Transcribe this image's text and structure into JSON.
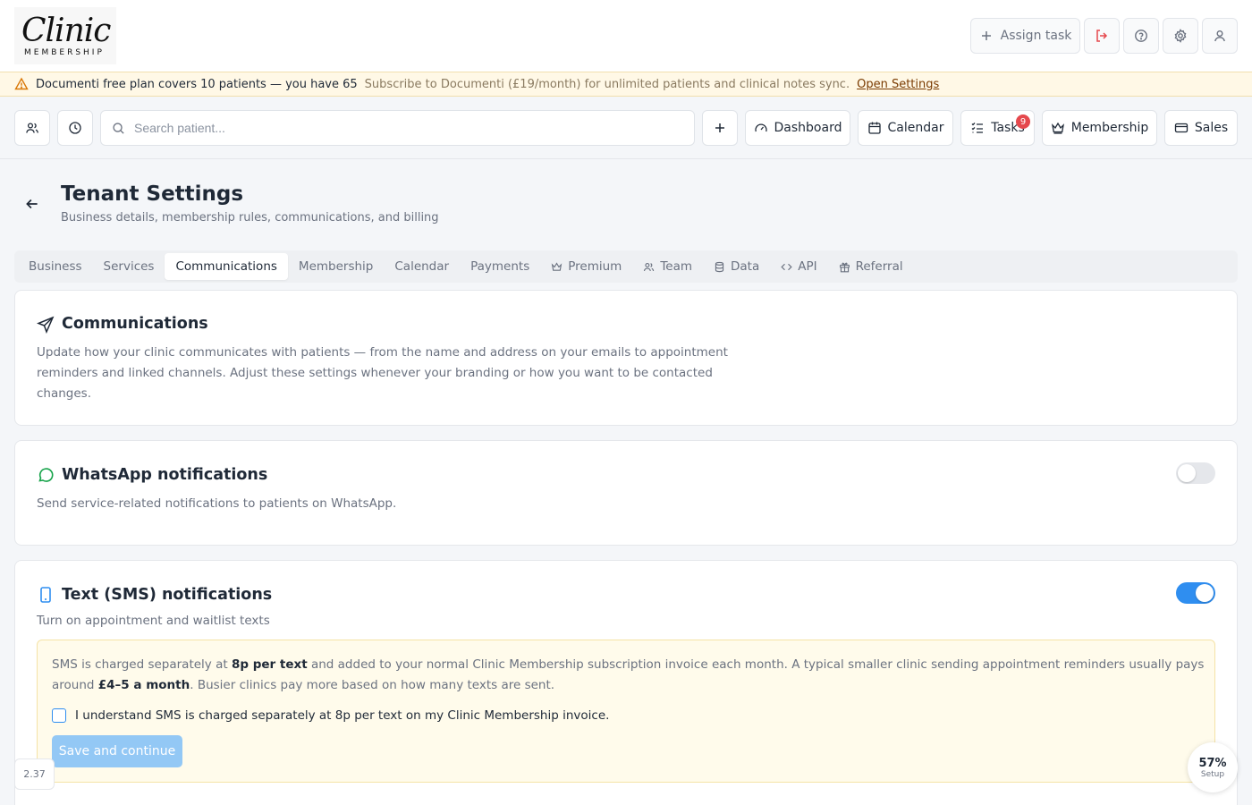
{
  "header": {
    "logo_script": "Clinic",
    "logo_sub": "MEMBERSHIP",
    "assign_task_label": "Assign task"
  },
  "banner": {
    "strong_text": "Documenti free plan covers 10 patients — you have 65",
    "muted_text": "Subscribe to Documenti (£19/month) for unlimited patients and clinical notes sync.",
    "link_text": "Open Settings"
  },
  "toolbar": {
    "search_placeholder": "Search patient...",
    "dashboard_label": "Dashboard",
    "calendar_label": "Calendar",
    "tasks_label": "Tasks",
    "tasks_count": "9",
    "membership_label": "Membership",
    "sales_label": "Sales"
  },
  "page": {
    "title": "Tenant Settings",
    "subtitle": "Business details, membership rules, communications, and billing"
  },
  "tabs": [
    {
      "label": "Business",
      "icon": ""
    },
    {
      "label": "Services",
      "icon": ""
    },
    {
      "label": "Communications",
      "icon": "",
      "active": true
    },
    {
      "label": "Membership",
      "icon": ""
    },
    {
      "label": "Calendar",
      "icon": ""
    },
    {
      "label": "Payments",
      "icon": ""
    },
    {
      "label": "Premium",
      "icon": "crown-icon"
    },
    {
      "label": "Team",
      "icon": "users-icon"
    },
    {
      "label": "Data",
      "icon": "database-icon"
    },
    {
      "label": "API",
      "icon": "code-icon"
    },
    {
      "label": "Referral",
      "icon": "gift-icon"
    }
  ],
  "communications": {
    "title": "Communications",
    "desc_line1": "Update how your clinic communicates with patients — from the name and address on your emails to appointment",
    "desc_line2": "reminders and linked channels. Adjust these settings whenever your branding or how you want to be contacted",
    "desc_line3": "changes."
  },
  "whatsapp": {
    "title": "WhatsApp notifications",
    "desc": "Send service-related notifications to patients on WhatsApp.",
    "enabled": false
  },
  "sms": {
    "title": "Text (SMS) notifications",
    "desc": "Turn on appointment and waitlist texts",
    "enabled": true,
    "notice_pre": "SMS is charged separately at ",
    "notice_bold1": "8p per text",
    "notice_mid": " and added to your normal Clinic Membership subscription invoice each month. A typical smaller clinic sending appointment reminders usually pays around ",
    "notice_bold2": "£4–5 a month",
    "notice_post": ". Busier clinics pay more based on how many texts are sent.",
    "checkbox_label": "I understand SMS is charged separately at 8p per text on my Clinic Membership invoice.",
    "save_label": "Save and continue"
  },
  "footer": {
    "version": "2.37",
    "setup_percent": "57%",
    "setup_label": "Setup"
  },
  "colors": {
    "accent": "#2f8ef0",
    "badge": "#e5484d",
    "banner_bg": "#fff8e6",
    "whatsapp_icon": "#16a34a"
  }
}
